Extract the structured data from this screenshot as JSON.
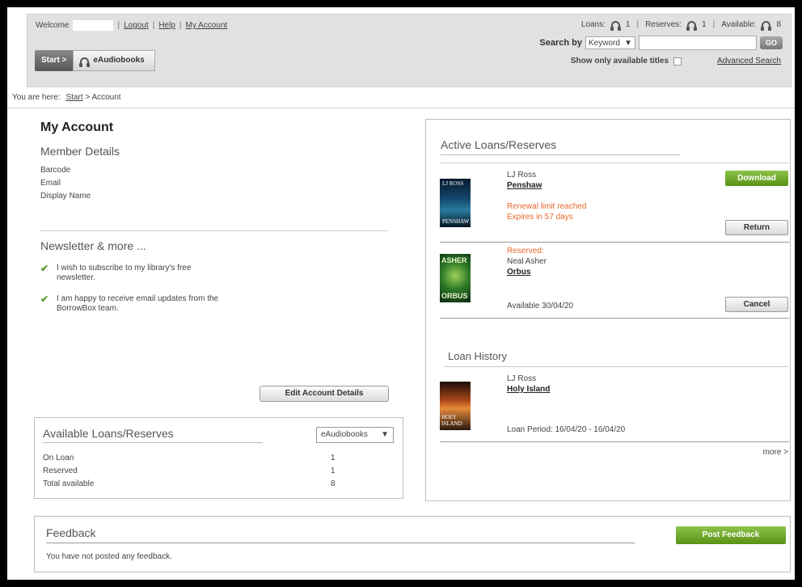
{
  "header": {
    "welcome_label": "Welcome",
    "links": {
      "logout": "Logout",
      "help": "Help",
      "my_account": "My Account"
    },
    "separator": "|",
    "tabs": {
      "start": "Start >",
      "eaudiobooks": "eAudiobooks"
    },
    "counts": {
      "loans_label": "Loans:",
      "loans_value": "1",
      "reserves_label": "Reserves:",
      "reserves_value": "1",
      "available_label": "Available:",
      "available_value": "8"
    },
    "search": {
      "label": "Search by",
      "type_selected": "Keyword",
      "go_label": "GO",
      "available_only_label": "Show only available titles",
      "advanced_label": "Advanced Search"
    }
  },
  "breadcrumb": {
    "prefix": "You are here:",
    "start": "Start",
    "current": "> Account"
  },
  "account": {
    "title": "My Account",
    "member_heading": "Member Details",
    "fields": [
      "Barcode",
      "Email",
      "Display Name"
    ],
    "newsletter_heading": "Newsletter & more ...",
    "newsletter_items": [
      "I wish to subscribe to my library's free newsletter.",
      "I am happy to receive email updates from the BorrowBox team."
    ],
    "edit_button": "Edit Account Details"
  },
  "available_box": {
    "title": "Available Loans/Reserves",
    "format_selected": "eAudiobooks",
    "rows": [
      {
        "label": "On Loan",
        "value": "1"
      },
      {
        "label": "Reserved",
        "value": "1"
      },
      {
        "label": "Total available",
        "value": "8"
      }
    ]
  },
  "active": {
    "title": "Active Loans/Reserves",
    "loan": {
      "author": "LJ Ross",
      "title": "Penshaw",
      "status1": "Renewal limit reached",
      "status2": "Expires in 57 days",
      "download": "Download",
      "return": "Return",
      "cover_text": "PENSHAW",
      "cover_author": "LJ ROSS"
    },
    "reserve": {
      "status": "Reserved:",
      "author": "Neal Asher",
      "title": "Orbus",
      "available": "Available 30/04/20",
      "cancel": "Cancel",
      "cover_top": "ASHER",
      "cover_bottom": "ORBUS"
    },
    "history_title": "Loan History",
    "history": {
      "author": "LJ Ross",
      "title": "Holy Island",
      "period": "Loan Period: 16/04/20 - 16/04/20",
      "cover_text": "HOLY ISLAND"
    },
    "more": "more >"
  },
  "feedback": {
    "title": "Feedback",
    "message": "You have not posted any feedback.",
    "post_button": "Post Feedback"
  },
  "colors": {
    "accent_green": "#6aa524",
    "warning_orange": "#e8662c"
  }
}
